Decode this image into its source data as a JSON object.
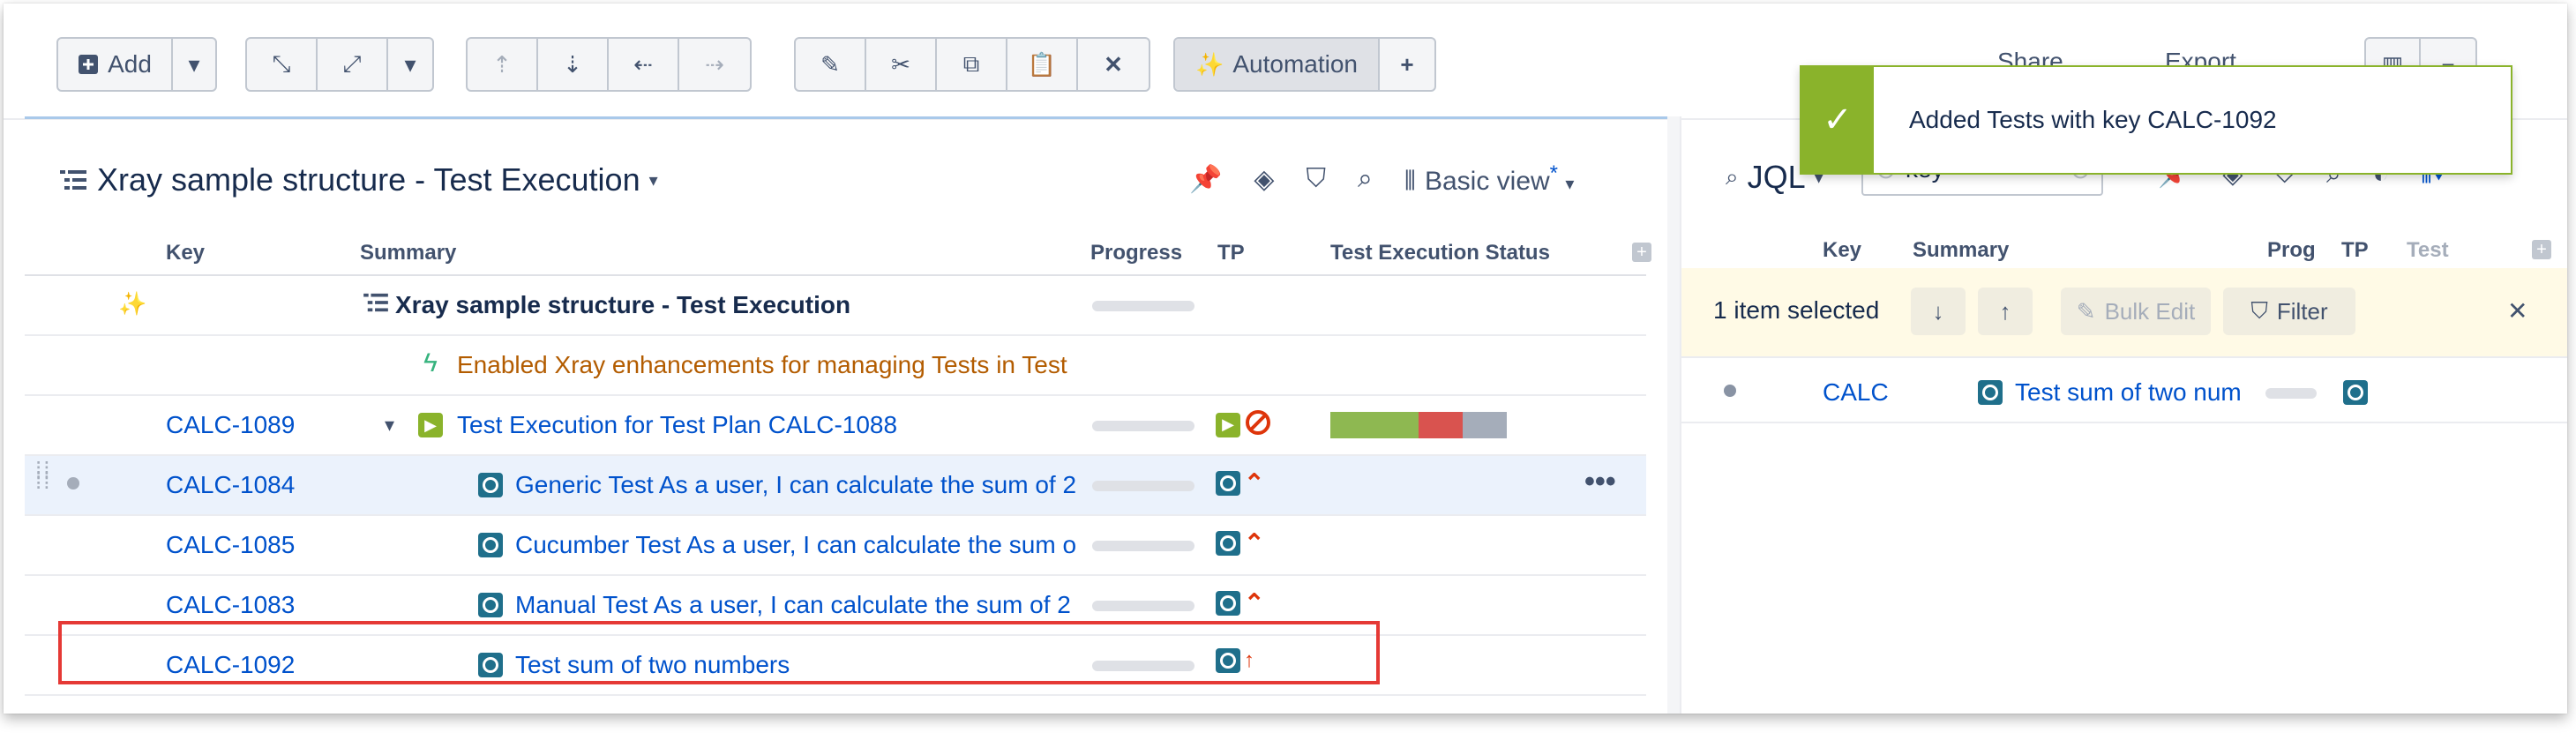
{
  "toolbar": {
    "add_label": "Add",
    "automation_label": "Automation"
  },
  "toast": {
    "message": "Added Tests with key CALC-1092"
  },
  "header_partial": {
    "share": "Share",
    "export": "Export"
  },
  "left_panel": {
    "title": "Xray sample structure - Test Execution",
    "view_label": "Basic view",
    "view_modified_mark": "*",
    "columns": {
      "key": "Key",
      "summary": "Summary",
      "progress": "Progress",
      "tp": "TP",
      "status": "Test Execution Status"
    },
    "rows": [
      {
        "key": "",
        "summary": "Xray sample structure - Test Execution"
      },
      {
        "key": "",
        "summary": "Enabled Xray enhancements for managing Tests in Test"
      },
      {
        "key": "CALC-1089",
        "summary": "Test Execution for Test Plan CALC-1088"
      },
      {
        "key": "CALC-1084",
        "summary": "Generic Test As a user, I can calculate the sum of 2"
      },
      {
        "key": "CALC-1085",
        "summary": "Cucumber Test As a user, I can calculate the sum o"
      },
      {
        "key": "CALC-1083",
        "summary": "Manual Test As a user, I can calculate the sum of 2"
      },
      {
        "key": "CALC-1092",
        "summary": "Test sum of two numbers"
      }
    ],
    "status_bar": [
      {
        "label": "passed",
        "fraction": 0.5,
        "color": "#8eb851"
      },
      {
        "label": "failed",
        "fraction": 0.25,
        "color": "#d9534f"
      },
      {
        "label": "todo",
        "fraction": 0.25,
        "color": "#a5adba"
      }
    ]
  },
  "right_panel": {
    "title": "JQL",
    "search_value": "key =",
    "columns": {
      "key": "Key",
      "summary": "Summary",
      "progress": "Prog",
      "tp": "TP",
      "test": "Test"
    },
    "selection_text": "1 item selected",
    "bulk_edit": "Bulk Edit",
    "filter": "Filter",
    "rows": [
      {
        "key": "CALC",
        "summary": "Test sum of two num"
      }
    ]
  }
}
